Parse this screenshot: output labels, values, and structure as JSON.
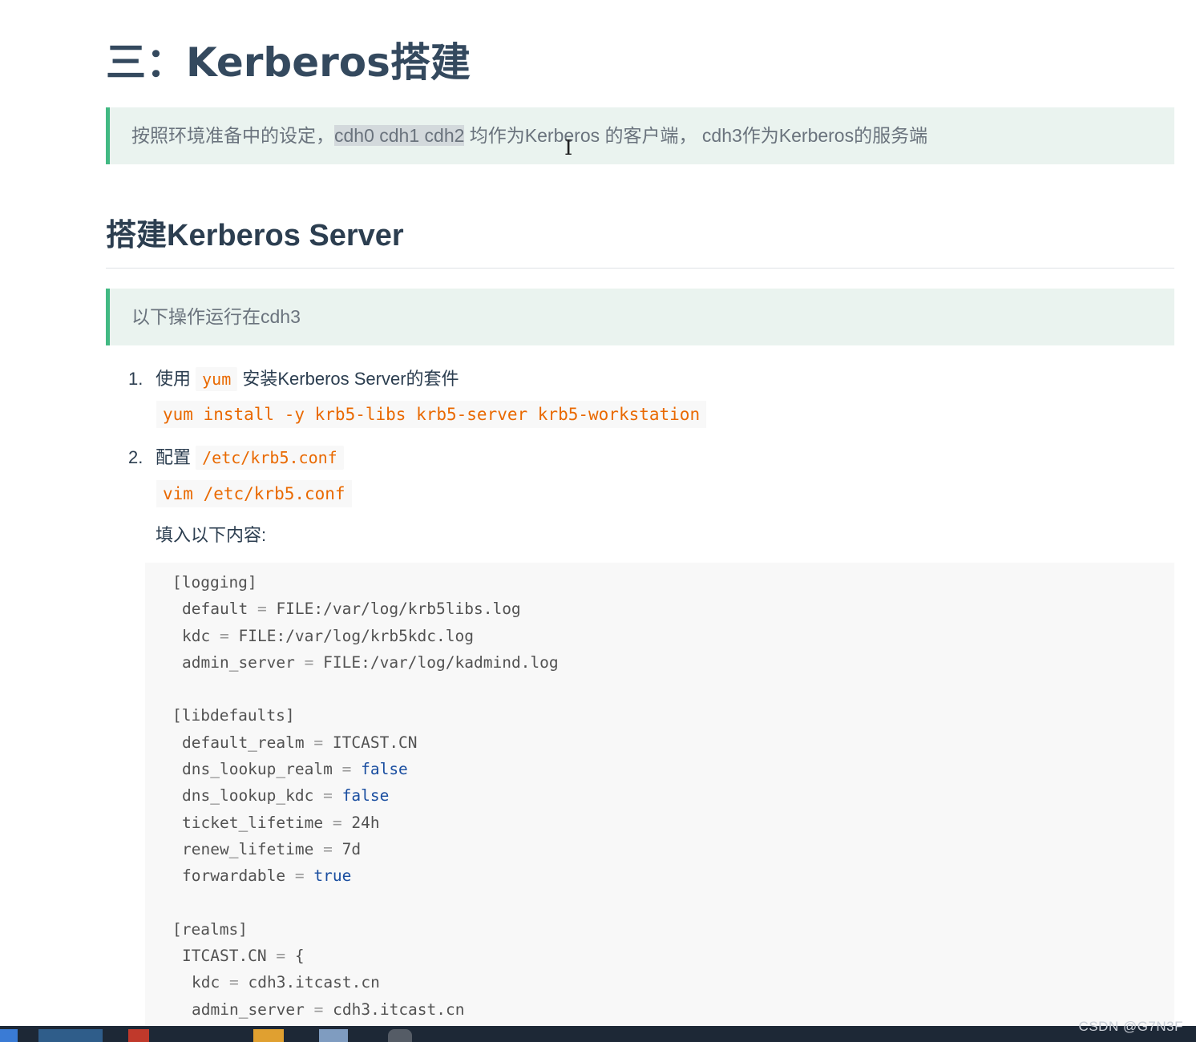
{
  "heading": "三：Kerberos搭建",
  "tip1": {
    "before": "按照环境准备中的设定，",
    "selected": "cdh0 cdh1 cdh2",
    "after": " 均作为Kerberos 的客户端， cdh3作为Kerberos的服务端"
  },
  "section_title": "搭建Kerberos Server",
  "tip2": "以下操作运行在cdh3",
  "steps": [
    {
      "num": "1.",
      "prefix": "使用 ",
      "code": "yum",
      "suffix": " 安装Kerberos Server的套件"
    },
    {
      "num": "2.",
      "prefix": "配置 ",
      "code": "/etc/krb5.conf",
      "suffix": ""
    }
  ],
  "commands": {
    "install": "yum install -y krb5-libs krb5-server krb5-workstation",
    "edit": "vim /etc/krb5.conf"
  },
  "fill_label": "填入以下内容:",
  "code": {
    "logging_header": "[logging]",
    "default": "default",
    "default_val": "FILE:/var/log/krb5libs.log",
    "kdc": "kdc",
    "kdc_val": "FILE:/var/log/krb5kdc.log",
    "admin_server": "admin_server",
    "admin_server_val": "FILE:/var/log/kadmind.log",
    "libdefaults_header": "[libdefaults]",
    "default_realm": "default_realm",
    "default_realm_val": "ITCAST.CN",
    "dns_lookup_realm": "dns_lookup_realm",
    "dns_lookup_realm_val": "false",
    "dns_lookup_kdc": "dns_lookup_kdc",
    "dns_lookup_kdc_val": "false",
    "ticket_lifetime": "ticket_lifetime",
    "ticket_lifetime_val": "24h",
    "renew_lifetime": "renew_lifetime",
    "renew_lifetime_val": "7d",
    "forwardable": "forwardable",
    "forwardable_val": "true",
    "realms_header": "[realms]",
    "realm_name": "ITCAST.CN",
    "realm_open": "{",
    "realm_kdc": "kdc",
    "realm_kdc_val": "cdh3.itcast.cn",
    "realm_admin_server": "admin_server",
    "realm_admin_server_val": "cdh3.itcast.cn",
    "eq": "="
  },
  "watermark": "CSDN @G7N3F",
  "colors": {
    "accent": "#42b983",
    "tip_bg": "#eaf3ef",
    "inline_code": "#e96900",
    "code_bg": "#f8f8f8",
    "keyword": "#1a4ea0"
  }
}
